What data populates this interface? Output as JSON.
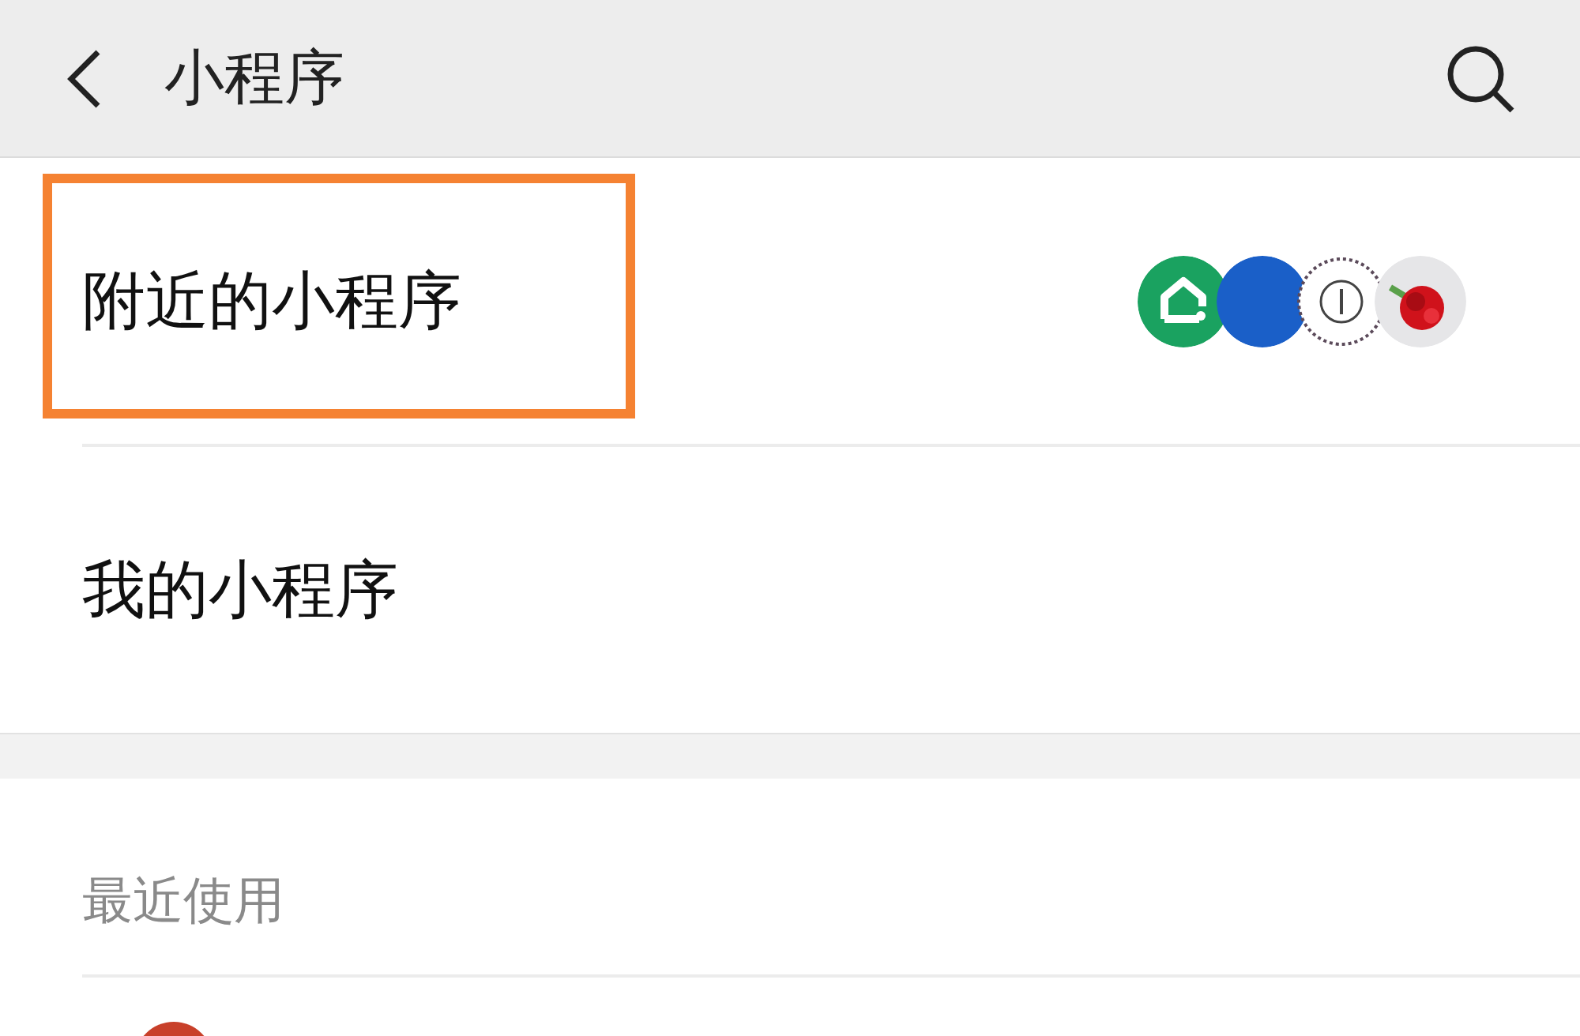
{
  "header": {
    "title": "小程序"
  },
  "menu": [
    {
      "label": "附近的小程序",
      "highlighted": true,
      "icons": [
        {
          "kind": "house"
        },
        {
          "kind": "disc"
        },
        {
          "kind": "seal"
        },
        {
          "kind": "picture"
        }
      ]
    },
    {
      "label": "我的小程序",
      "highlighted": false
    }
  ],
  "recent": {
    "title": "最近使用",
    "items": [
      {
        "kind": "avatar"
      }
    ]
  }
}
